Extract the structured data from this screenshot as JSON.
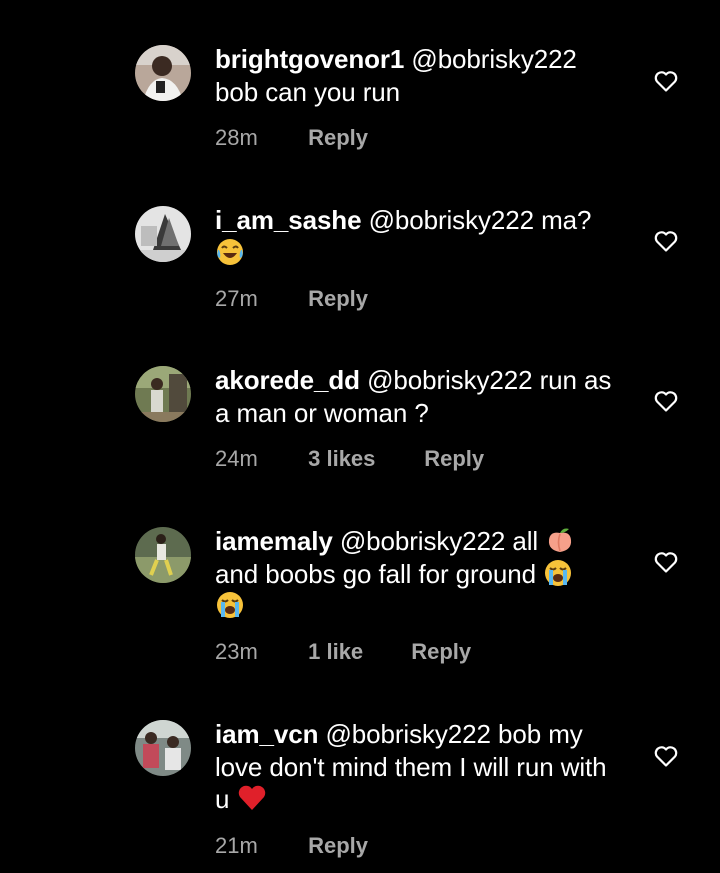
{
  "comments": [
    {
      "username": "brightgovenor1",
      "mention": "@bobrisky222",
      "text": "bob can you run",
      "emojis": [],
      "time": "28m",
      "likes": "",
      "reply_label": "Reply",
      "avatar_icon": "avatar-photo-person"
    },
    {
      "username": "i_am_sashe",
      "mention": "@bobrisky222",
      "text": "ma?",
      "emojis": [
        "laughing-emoji"
      ],
      "time": "27m",
      "likes": "",
      "reply_label": "Reply",
      "avatar_icon": "avatar-photo-grayscale"
    },
    {
      "username": "akorede_dd",
      "mention": "@bobrisky222",
      "text": "run as a man or woman ?",
      "emojis": [],
      "time": "24m",
      "likes": "3 likes",
      "reply_label": "Reply",
      "avatar_icon": "avatar-photo-outdoor"
    },
    {
      "username": "iamemaly",
      "mention": "@bobrisky222",
      "text": "all",
      "text2": "and boobs go fall for ground",
      "emojis": [
        "peach-emoji",
        "crying-emoji",
        "crying-emoji"
      ],
      "time": "23m",
      "likes": "1 like",
      "reply_label": "Reply",
      "avatar_icon": "avatar-photo-dancing"
    },
    {
      "username": "iam_vcn",
      "mention": "@bobrisky222",
      "text": "bob my love don't mind them I will run with u",
      "emojis": [
        "red-heart-emoji"
      ],
      "time": "21m",
      "likes": "",
      "reply_label": "Reply",
      "avatar_icon": "avatar-photo-group"
    }
  ],
  "colors": {
    "background": "#000000",
    "primary_text": "#ffffff",
    "secondary_text": "#a8a8a8",
    "heart_outline": "#ffffff"
  }
}
